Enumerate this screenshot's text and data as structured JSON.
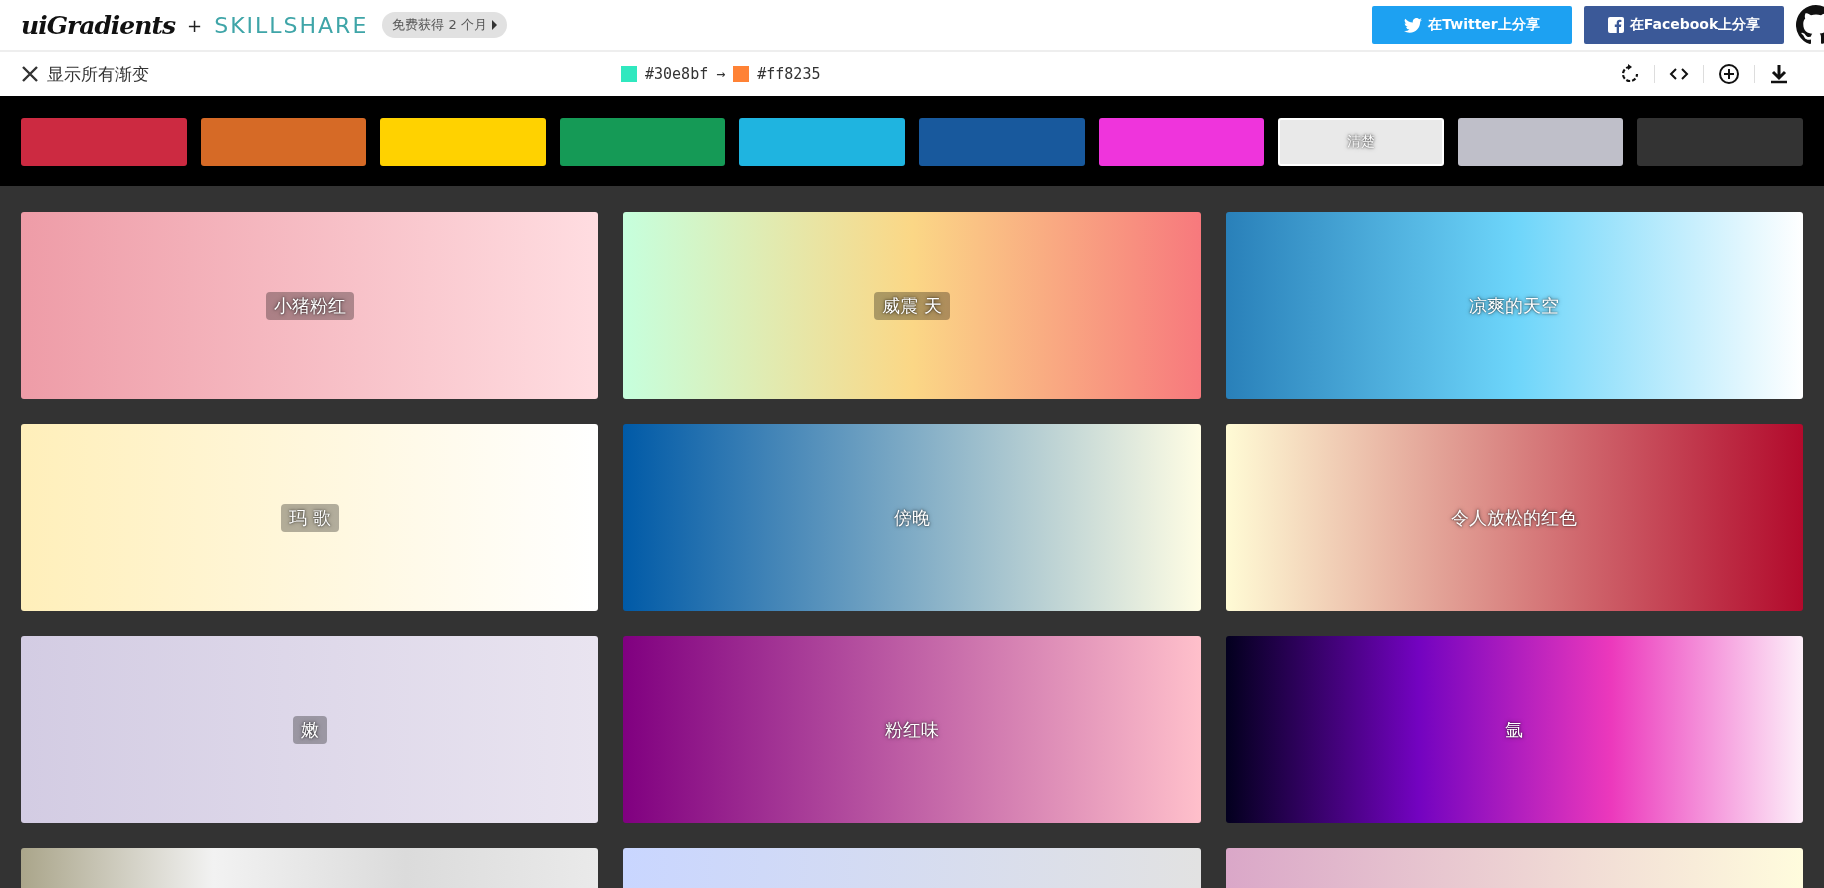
{
  "header": {
    "logo": "uiGradients",
    "plus": "+",
    "partner": "SKILLSHARE",
    "promo": "免费获得 2 个月",
    "share_buttons": [
      {
        "kind": "twitter",
        "label": "在Twitter上分享"
      },
      {
        "kind": "facebook",
        "label": "在Facebook上分享"
      }
    ]
  },
  "toolbar": {
    "show_all": "显示所有渐变",
    "from": {
      "color": "#30e8bf",
      "label": "#30e8bf"
    },
    "arrow": "→",
    "to": {
      "color": "#ff8235",
      "label": "#ff8235"
    }
  },
  "filters": [
    {
      "color": "#cc2a41",
      "selected": false
    },
    {
      "color": "#d66a26",
      "selected": false
    },
    {
      "color": "#ffd200",
      "selected": false
    },
    {
      "color": "#159a56",
      "selected": false
    },
    {
      "color": "#1fb4e0",
      "selected": false
    },
    {
      "color": "#18599d",
      "selected": false
    },
    {
      "color": "#ef34dc",
      "selected": false
    },
    {
      "color": "#e9e9e9",
      "selected": true,
      "label": "清楚"
    },
    {
      "color": "#bfbfc9",
      "selected": false
    },
    {
      "color": "#333333",
      "selected": false
    }
  ],
  "gradients": [
    {
      "name": "小猪粉红",
      "stops": [
        {
          "color": "#ee9ca7"
        },
        {
          "color": "#ffdde1"
        }
      ]
    },
    {
      "name": "威震 天",
      "stops": [
        {
          "color": "#c6ffdd"
        },
        {
          "color": "#fbd786"
        },
        {
          "color": "#f7797d"
        }
      ]
    },
    {
      "name": "凉爽的天空",
      "stops": [
        {
          "color": "#2980b9"
        },
        {
          "color": "#6dd5fa"
        },
        {
          "color": "#ffffff"
        }
      ]
    },
    {
      "name": "玛 歌",
      "stops": [
        {
          "color": "#ffefba"
        },
        {
          "color": "#ffffff"
        }
      ]
    },
    {
      "name": "傍晚",
      "stops": [
        {
          "color": "#005aa7"
        },
        {
          "color": "#fffde4"
        }
      ]
    },
    {
      "name": "令人放松的红色",
      "stops": [
        {
          "color": "#fffbd5"
        },
        {
          "color": "#b20a2c"
        }
      ]
    },
    {
      "name": "嫩",
      "stops": [
        {
          "color": "#d3cce3"
        },
        {
          "color": "#e9e4f0"
        }
      ]
    },
    {
      "name": "粉红味",
      "stops": [
        {
          "color": "#800080"
        },
        {
          "color": "#ffc0cb"
        }
      ]
    },
    {
      "name": "氩",
      "stops": [
        {
          "color": "#03001e"
        },
        {
          "color": "#7303c0"
        },
        {
          "color": "#ec38bc"
        },
        {
          "color": "#fdeff9"
        }
      ]
    },
    {
      "stops": [
        {
          "color": "#aaa58a"
        },
        {
          "color": "#f2f2f2"
        },
        {
          "color": "#dbdbdb"
        },
        {
          "color": "#eaeaea"
        }
      ]
    },
    {
      "stops": [
        {
          "color": "#c9d6ff"
        },
        {
          "color": "#e2e2e2"
        }
      ]
    },
    {
      "stops": [
        {
          "color": "#daa7c8"
        },
        {
          "color": "#fffcdd"
        }
      ]
    }
  ]
}
